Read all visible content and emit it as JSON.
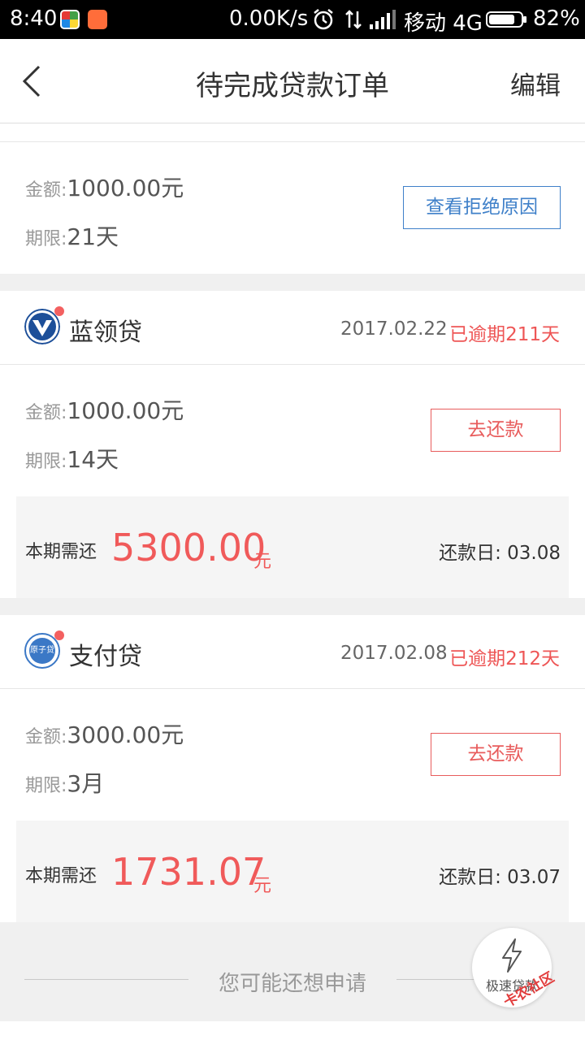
{
  "status_bar": {
    "time": "8:40",
    "network_speed": "0.00K/s",
    "carrier": "移动 4G",
    "battery": "82%",
    "battery_level": 0.82
  },
  "header": {
    "title": "待完成贷款订单",
    "edit_label": "编辑"
  },
  "orders": [
    {
      "amount_label": "金额:",
      "amount": "1000.00元",
      "term_label": "期限:",
      "term": "21天",
      "action_label": "查看拒绝原因"
    },
    {
      "name": "蓝领贷",
      "date": "2017.02.22",
      "status": "已逾期211天",
      "amount_label": "金额:",
      "amount": "1000.00元",
      "term_label": "期限:",
      "term": "14天",
      "action_label": "去还款",
      "due_label": "本期需还",
      "due_amount": "5300.00",
      "due_unit": "元",
      "due_date": "还款日: 03.08"
    },
    {
      "name": "支付贷",
      "logo_text": "原子贷",
      "date": "2017.02.08",
      "status": "已逾期212天",
      "amount_label": "金额:",
      "amount": "3000.00元",
      "term_label": "期限:",
      "term": "3月",
      "action_label": "去还款",
      "due_label": "本期需还",
      "due_amount": "1731.07",
      "due_unit": "元",
      "due_date": "还款日: 03.07"
    }
  ],
  "suggest_label": "您可能还想申请",
  "fab_label": "极速贷款",
  "watermark": "卡农社区",
  "colors": {
    "accent_red": "#f05a5a",
    "link_blue": "#3f80c9"
  }
}
